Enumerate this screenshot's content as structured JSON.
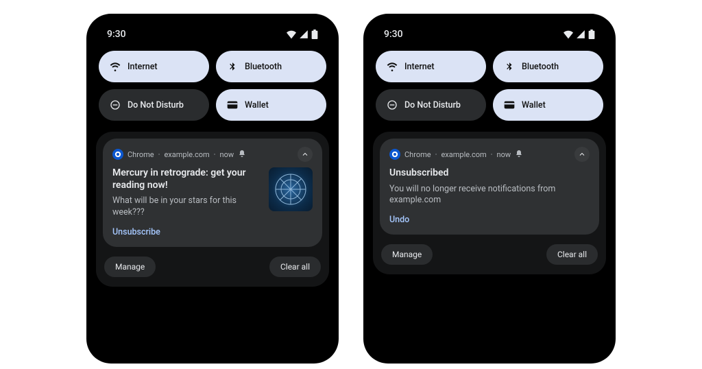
{
  "statusbar": {
    "time": "9:30"
  },
  "qs": {
    "internet": "Internet",
    "bluetooth": "Bluetooth",
    "dnd": "Do Not Disturb",
    "wallet": "Wallet"
  },
  "phoneA": {
    "notif": {
      "app": "Chrome",
      "site": "example.com",
      "time": "now",
      "title": "Mercury in retrograde: get your reading now!",
      "body": "What will be in your stars for this week???",
      "action": "Unsubscribe"
    }
  },
  "phoneB": {
    "notif": {
      "app": "Chrome",
      "site": "example.com",
      "time": "now",
      "title": "Unsubscribed",
      "body": "You will no longer receive notifications from example.com",
      "action": "Undo"
    }
  },
  "shade": {
    "manage": "Manage",
    "clearall": "Clear all"
  }
}
